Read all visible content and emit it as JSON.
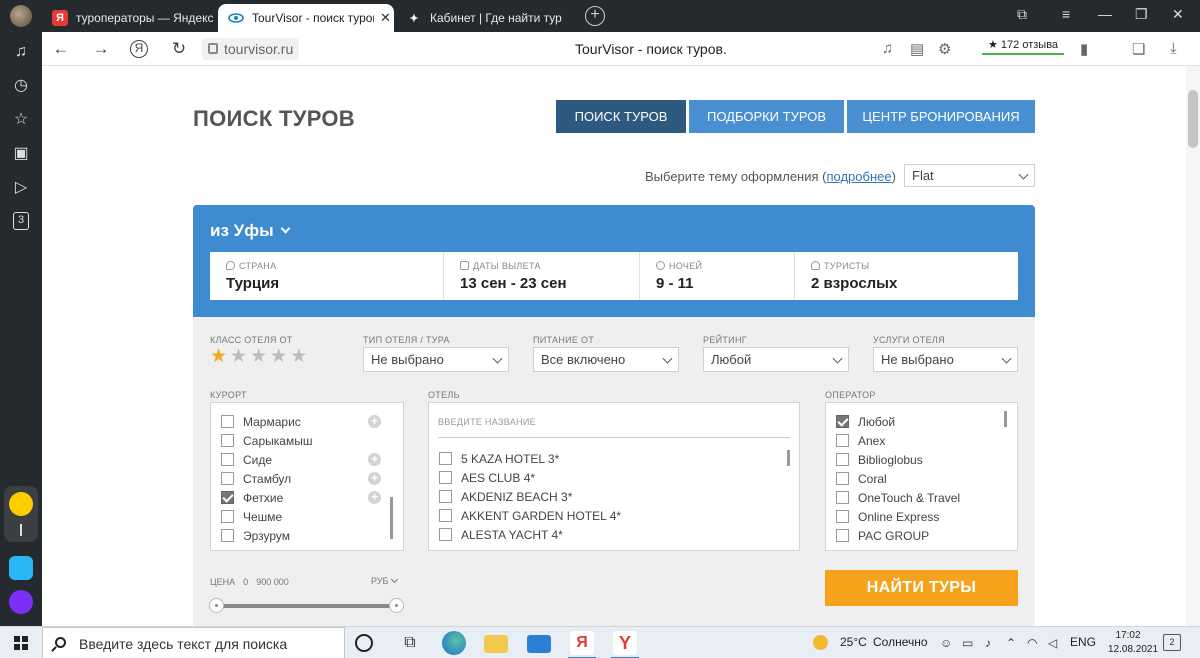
{
  "browser": {
    "tabs": [
      {
        "title": "туроператоры — Яндекс",
        "favicon": "Я",
        "active": false
      },
      {
        "title": "TourVisor - поиск туров",
        "favicon": "tv",
        "active": true
      },
      {
        "title": "Кабинет | Где найти тур п",
        "favicon": "✦",
        "active": false
      }
    ],
    "url": "tourvisor.ru",
    "page_title": "TourVisor - поиск туров.",
    "reviews_label": "★ 172 отзыва"
  },
  "site": {
    "heading": "ПОИСК ТУРОВ",
    "nav": [
      {
        "label": "ПОИСК ТУРОВ",
        "active": true
      },
      {
        "label": "ПОДБОРКИ ТУРОВ",
        "active": false
      },
      {
        "label": "ЦЕНТР БРОНИРОВАНИЯ",
        "active": false
      }
    ],
    "theme": {
      "label": "Выберите тему оформления (",
      "link": "подробнее",
      "label_end": ")",
      "value": "Flat"
    }
  },
  "search": {
    "from_city": "из Уфы",
    "country": {
      "label": "СТРАНА",
      "value": "Турция"
    },
    "dates": {
      "label": "ДАТЫ ВЫЛЕТА",
      "value": "13 сен - 23 сен"
    },
    "nights": {
      "label": "НОЧЕЙ",
      "value": "9 - 11"
    },
    "tourists": {
      "label": "ТУРИСТЫ",
      "value": "2 взрослых"
    }
  },
  "filters": {
    "hotel_class": {
      "label": "КЛАСС ОТЕЛЯ ОТ",
      "stars_selected": 1,
      "stars_total": 5
    },
    "hotel_type": {
      "label": "ТИП ОТЕЛЯ / ТУРА",
      "value": "Не выбрано"
    },
    "meal": {
      "label": "ПИТАНИЕ ОТ",
      "value": "Все включено"
    },
    "rating": {
      "label": "РЕЙТИНГ",
      "value": "Любой"
    },
    "services": {
      "label": "УСЛУГИ ОТЕЛЯ",
      "value": "Не выбрано"
    },
    "resort": {
      "label": "КУРОРТ",
      "items": [
        {
          "name": "Мармарис",
          "checked": false,
          "plus": true
        },
        {
          "name": "Сарыкамыш",
          "checked": false,
          "plus": false
        },
        {
          "name": "Сиде",
          "checked": false,
          "plus": true
        },
        {
          "name": "Стамбул",
          "checked": false,
          "plus": true
        },
        {
          "name": "Фетхие",
          "checked": true,
          "plus": true
        },
        {
          "name": "Чешме",
          "checked": false,
          "plus": false
        },
        {
          "name": "Эрзурум",
          "checked": false,
          "plus": false
        }
      ]
    },
    "hotel": {
      "label": "ОТЕЛЬ",
      "placeholder": "ВВЕДИТЕ НАЗВАНИЕ",
      "items": [
        {
          "name": "5 KAZA HOTEL 3*",
          "checked": false
        },
        {
          "name": "AES CLUB 4*",
          "checked": false
        },
        {
          "name": "AKDENIZ BEACH 3*",
          "checked": false
        },
        {
          "name": "AKKENT GARDEN HOTEL 4*",
          "checked": false
        },
        {
          "name": "ALESTA YACHT 4*",
          "checked": false
        }
      ]
    },
    "operator": {
      "label": "ОПЕРАТОР",
      "items": [
        {
          "name": "Любой",
          "checked": true
        },
        {
          "name": "Anex",
          "checked": false
        },
        {
          "name": "Biblioglobus",
          "checked": false
        },
        {
          "name": "Coral",
          "checked": false
        },
        {
          "name": "OneTouch & Travel",
          "checked": false
        },
        {
          "name": "Online Express",
          "checked": false
        },
        {
          "name": "PAC GROUP",
          "checked": false
        }
      ]
    },
    "price": {
      "label": "ЦЕНА",
      "min": "0",
      "max": "900 000",
      "currency": "РУБ"
    },
    "find_button": "НАЙТИ ТУРЫ"
  },
  "taskbar": {
    "search_placeholder": "Введите здесь текст для поиска",
    "weather_temp": "25°C",
    "weather_text": "Солнечно",
    "language": "ENG",
    "time": "17:02",
    "date": "12.08.2021",
    "notifications": "2"
  }
}
